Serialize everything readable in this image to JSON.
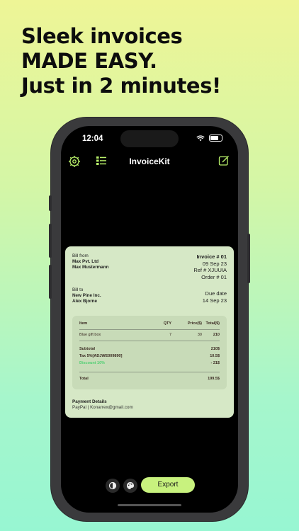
{
  "headline": {
    "line1": "Sleek invoices",
    "line2": "MADE EASY.",
    "line3": "Just in 2 minutes!"
  },
  "status_bar": {
    "time": "12:04"
  },
  "navbar": {
    "title": "InvoiceKit",
    "left_icons": [
      "gear-icon",
      "list-icon"
    ],
    "right_icon": "edit-icon",
    "accent_color": "#b8f06a"
  },
  "invoice": {
    "bill_from_label": "Bill from",
    "bill_from_company": "Max Pvt. Ltd",
    "bill_from_person": "Max Mustermann",
    "invoice_number": "Invoice # 01",
    "invoice_date": "09 Sep 23",
    "reference": "Ref # XJUUIA",
    "order": "Order # 01",
    "bill_to_label": "Bill to",
    "bill_to_company": "New Pine Inc.",
    "bill_to_person": "Alex Bjorne",
    "due_date_label": "Due date",
    "due_date": "14 Sep 23",
    "table": {
      "headers": {
        "item": "Item",
        "qty": "QTY",
        "price": "Price($)",
        "total": "Total($)"
      },
      "rows": [
        {
          "item": "Blue gift box",
          "qty": "7",
          "price": "30",
          "total": "210"
        }
      ]
    },
    "summary": {
      "subtotal_label": "Subtotal",
      "subtotal_value": "210$",
      "tax_label": "Tax 5%[ADJWE009890]",
      "tax_value": "10.5$",
      "discount_label": "Discount 10%",
      "discount_value": "- 21$",
      "total_label": "Total",
      "total_value": "199.5$"
    },
    "payment_title": "Payment Details",
    "payment_value": "PayPal | Konarrex@gmail.com"
  },
  "bottom_bar": {
    "export_label": "Export",
    "icons": [
      "theme-icon",
      "palette-icon"
    ],
    "export_color": "#c8f27e"
  }
}
